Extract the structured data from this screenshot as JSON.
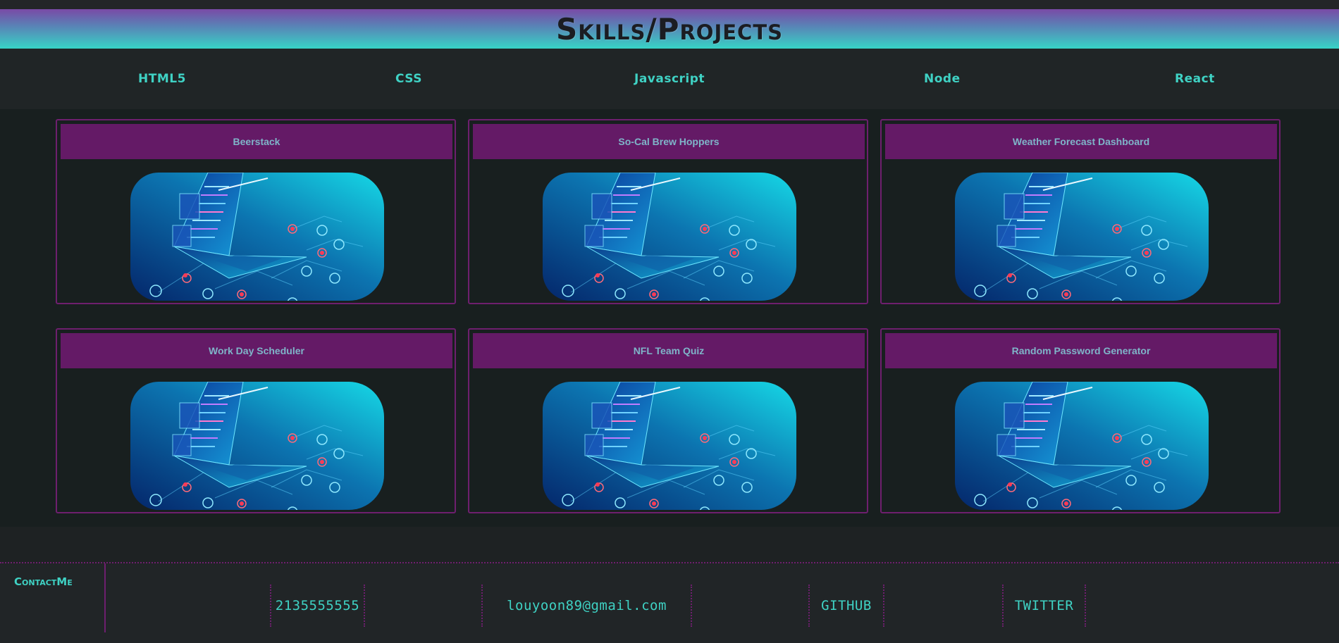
{
  "header": {
    "title": "Skills/Projects"
  },
  "skills": [
    "HTML5",
    "CSS",
    "Javascript",
    "Node",
    "React"
  ],
  "projects": [
    {
      "title": "Beerstack"
    },
    {
      "title": "So-Cal Brew Hoppers"
    },
    {
      "title": "Weather Forecast Dashboard"
    },
    {
      "title": "Work Day Scheduler"
    },
    {
      "title": "NFL Team Quiz"
    },
    {
      "title": "Random Password Generator"
    }
  ],
  "footer": {
    "contact_title": "ContactMe",
    "phone": "2135555555",
    "email": "louyoon89@gmail.com",
    "github": "GITHUB",
    "twitter": "TWITTER"
  },
  "colors": {
    "accent": "#3fd2c4",
    "card_border": "#6e1f6e",
    "card_header": "#641a66"
  },
  "icons": [
    "laptop-illustration-icon"
  ]
}
